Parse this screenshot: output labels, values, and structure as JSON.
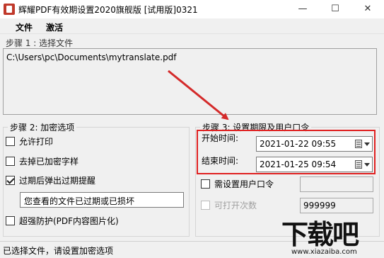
{
  "window": {
    "title": "辉耀PDF有效期设置2020旗舰版 [试用版]0321",
    "minimize_glyph": "—",
    "maximize_glyph": "☐",
    "close_glyph": "✕"
  },
  "menu": {
    "file": "文件",
    "activate": "激活"
  },
  "step1": {
    "label": "步骤 1 : 选择文件",
    "file_path": "C:\\Users\\pc\\Documents\\mytranslate.pdf"
  },
  "step2": {
    "legend": "步骤 2:  加密选项",
    "allow_print": {
      "label": "允许打印",
      "checked": false
    },
    "remove_watermark": {
      "label": "去掉已加密字样",
      "checked": false
    },
    "expire_popup": {
      "label": "过期后弹出过期提醒",
      "checked": true
    },
    "expire_message": "您查看的文件已过期或已损坏",
    "strong_protect": {
      "label": "超强防护(PDF内容图片化)",
      "checked": false
    }
  },
  "step3": {
    "legend": "步骤 3: 设置期限及用户口令",
    "start_label": "开始时间:",
    "start_value": "2021-01-22 09:55",
    "end_label": "结束时间:",
    "end_value": "2021-01-25 09:54",
    "need_password": {
      "label": "需设置用户口令",
      "checked": false
    },
    "password_value": "",
    "open_count": {
      "label": "可打开次数",
      "checked": false,
      "disabled": true
    },
    "open_count_value": "999999"
  },
  "status": {
    "text": "已选择文件，请设置加密选项"
  },
  "watermark": {
    "main": "下载吧",
    "url": "www.xiazaiba.com"
  },
  "colors": {
    "highlight": "#e02020",
    "annotation_arrow": "#d42a2a"
  }
}
